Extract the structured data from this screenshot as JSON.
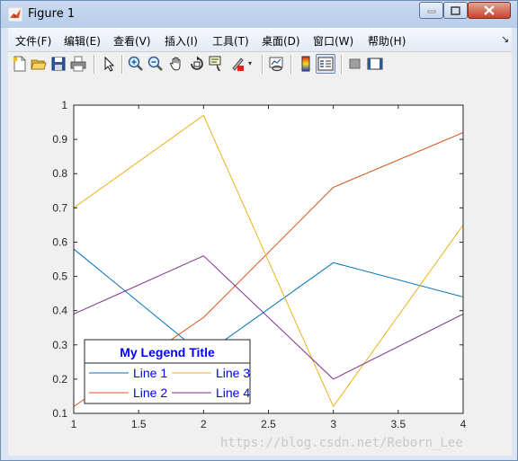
{
  "window": {
    "title": "Figure 1"
  },
  "menu": {
    "items": [
      "文件(F)",
      "编辑(E)",
      "查看(V)",
      "插入(I)",
      "工具(T)",
      "桌面(D)",
      "窗口(W)",
      "帮助(H)"
    ]
  },
  "toolbar": {
    "icons": [
      "new-figure-icon",
      "open-file-icon",
      "save-icon",
      "print-icon",
      "pointer-icon",
      "zoom-in-icon",
      "zoom-out-icon",
      "pan-icon",
      "rotate-3d-icon",
      "data-cursor-icon",
      "brush-icon",
      "link-plot-icon",
      "colorbar-icon",
      "legend-icon",
      "hide-plot-tools-icon",
      "show-plot-tools-icon"
    ]
  },
  "chart_data": {
    "type": "line",
    "title": "",
    "xlabel": "",
    "ylabel": "",
    "xlim": [
      1,
      4
    ],
    "ylim": [
      0.1,
      1
    ],
    "xticks": [
      "1",
      "1.5",
      "2",
      "2.5",
      "3",
      "3.5",
      "4"
    ],
    "yticks": [
      "0.1",
      "0.2",
      "0.3",
      "0.4",
      "0.5",
      "0.6",
      "0.7",
      "0.8",
      "0.9",
      "1"
    ],
    "grid": false,
    "x": [
      1,
      2,
      3,
      4
    ],
    "series": [
      {
        "name": "Line 1",
        "color": "#0072bd",
        "values": [
          0.58,
          0.27,
          0.54,
          0.44
        ]
      },
      {
        "name": "Line 2",
        "color": "#d95319",
        "values": [
          0.12,
          0.38,
          0.76,
          0.92
        ]
      },
      {
        "name": "Line 3",
        "color": "#edb120",
        "values": [
          0.7,
          0.97,
          0.12,
          0.65
        ]
      },
      {
        "name": "Line 4",
        "color": "#7e2f8e",
        "values": [
          0.39,
          0.56,
          0.2,
          0.39
        ]
      }
    ],
    "legend": {
      "title": "My Legend Title",
      "placement": "bottom-left",
      "columns": 2,
      "text_color": "#0000ff"
    }
  },
  "watermark": "https://blog.csdn.net/Reborn_Lee"
}
